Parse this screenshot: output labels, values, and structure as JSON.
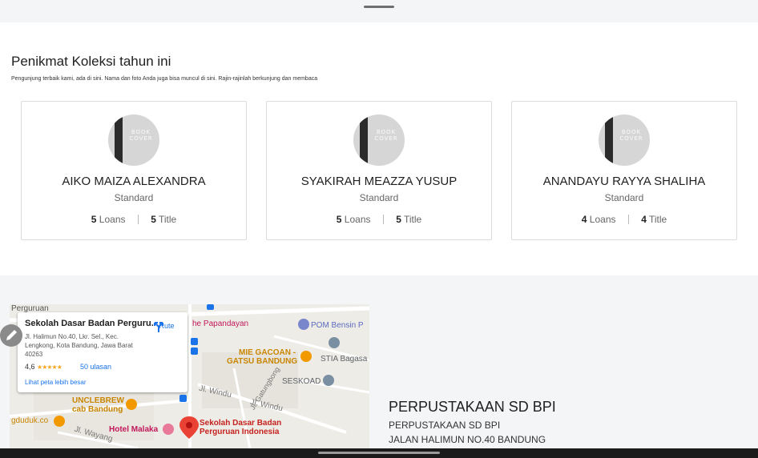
{
  "section": {
    "title": "Penikmat Koleksi tahun ini",
    "subtitle": "Pengunjung terbaik kami, ada di sini. Nama dan foto Anda juga bisa muncul di sini. Rajin-rajinlah berkunjung dan membaca"
  },
  "avatar_text": "BOOK COVER",
  "members": [
    {
      "name": "AIKO MAIZA ALEXANDRA",
      "level": "Standard",
      "loans": "5",
      "loans_label": "Loans",
      "titles": "5",
      "titles_label": "Title"
    },
    {
      "name": "SYAKIRAH MEAZZA YUSUP",
      "level": "Standard",
      "loans": "5",
      "loans_label": "Loans",
      "titles": "5",
      "titles_label": "Title"
    },
    {
      "name": "ANANDAYU RAYYA SHALIHA",
      "level": "Standard",
      "loans": "4",
      "loans_label": "Loans",
      "titles": "4",
      "titles_label": "Title"
    }
  ],
  "map": {
    "place_title": "Sekolah Dasar Badan Perguru...",
    "address": "Jl. Halimun No.40, Lkr. Sel., Kec. Lengkong, Kota Bandung, Jawa Barat 40263",
    "rating": "4,6",
    "stars": "★★★★★",
    "reviews": "50 ulasan",
    "larger_map_link": "Lihat peta lebih besar",
    "route_label": "Rute",
    "labels": {
      "perguruan": "Perguruan",
      "papandayan": "he Papandayan",
      "pom_bensin": "POM Bensin P",
      "mie_gacoan_1": "MIE GACOAN -",
      "mie_gacoan_2": "GATSU BANDUNG",
      "stia": "STIA Bagasa",
      "seskoad": "SESKOAD",
      "jl_windu_1": "Jl. Windu",
      "jl_gatungbong": "Jl. Gatungbong",
      "jl_windu_2": "Jl. Windu",
      "unclebrew_1": "UNCLEBREW",
      "unclebrew_2": "cab Bandung",
      "gduduk": "gduduk.co",
      "hotel_malaka": "Hotel Malaka",
      "jl_wayang": "Jl. Wayang",
      "school_1": "Sekolah Dasar Badan",
      "school_2": "Perguruan Indonesia"
    }
  },
  "library": {
    "name": "PERPUSTAKAAN SD BPI",
    "line1": "PERPUSTAKAAN SD BPI",
    "line2": "JALAN HALIMUN NO.40 BANDUNG"
  },
  "colors": {
    "card_border": "#dcdcdc",
    "bottom_bg": "#f4f5f7",
    "map_link": "#1a73e8",
    "map_pin": "#ea4335"
  }
}
